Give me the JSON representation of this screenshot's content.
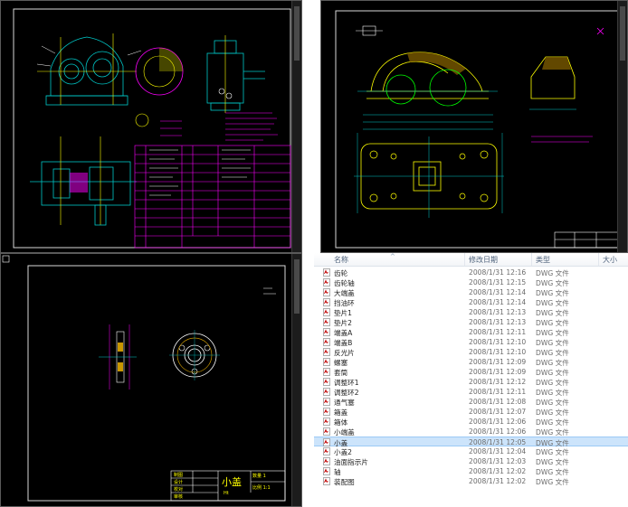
{
  "panel_bottom_left": {
    "title_block": {
      "part_name": "小盖",
      "rows": [
        "制图",
        "设计",
        "校对",
        "审核"
      ],
      "cells": [
        "Ht",
        "比例 1:1",
        "数量 1"
      ]
    }
  },
  "explorer": {
    "columns": {
      "name": "名称",
      "date": "修改日期",
      "type": "类型",
      "size": "大小"
    },
    "files": [
      {
        "name": "齿轮",
        "date": "2008/1/31 12:16",
        "type": "DWG 文件"
      },
      {
        "name": "齿轮轴",
        "date": "2008/1/31 12:15",
        "type": "DWG 文件"
      },
      {
        "name": "大端盖",
        "date": "2008/1/31 12:14",
        "type": "DWG 文件"
      },
      {
        "name": "挡油环",
        "date": "2008/1/31 12:14",
        "type": "DWG 文件"
      },
      {
        "name": "垫片1",
        "date": "2008/1/31 12:13",
        "type": "DWG 文件"
      },
      {
        "name": "垫片2",
        "date": "2008/1/31 12:13",
        "type": "DWG 文件"
      },
      {
        "name": "端盖A",
        "date": "2008/1/31 12:11",
        "type": "DWG 文件"
      },
      {
        "name": "端盖B",
        "date": "2008/1/31 12:10",
        "type": "DWG 文件"
      },
      {
        "name": "反光片",
        "date": "2008/1/31 12:10",
        "type": "DWG 文件"
      },
      {
        "name": "螺塞",
        "date": "2008/1/31 12:09",
        "type": "DWG 文件"
      },
      {
        "name": "套筒",
        "date": "2008/1/31 12:09",
        "type": "DWG 文件"
      },
      {
        "name": "调整环1",
        "date": "2008/1/31 12:12",
        "type": "DWG 文件"
      },
      {
        "name": "调整环2",
        "date": "2008/1/31 12:11",
        "type": "DWG 文件"
      },
      {
        "name": "通气塞",
        "date": "2008/1/31 12:08",
        "type": "DWG 文件"
      },
      {
        "name": "箱盖",
        "date": "2008/1/31 12:07",
        "type": "DWG 文件"
      },
      {
        "name": "箱体",
        "date": "2008/1/31 12:06",
        "type": "DWG 文件"
      },
      {
        "name": "小端盖",
        "date": "2008/1/31 12:06",
        "type": "DWG 文件"
      },
      {
        "name": "小盖",
        "date": "2008/1/31 12:05",
        "type": "DWG 文件",
        "selected": true
      },
      {
        "name": "小盖2",
        "date": "2008/1/31 12:04",
        "type": "DWG 文件"
      },
      {
        "name": "油面指示片",
        "date": "2008/1/31 12:03",
        "type": "DWG 文件"
      },
      {
        "name": "轴",
        "date": "2008/1/31 12:02",
        "type": "DWG 文件"
      },
      {
        "name": "装配图",
        "date": "2008/1/31 12:02",
        "type": "DWG 文件"
      }
    ]
  }
}
